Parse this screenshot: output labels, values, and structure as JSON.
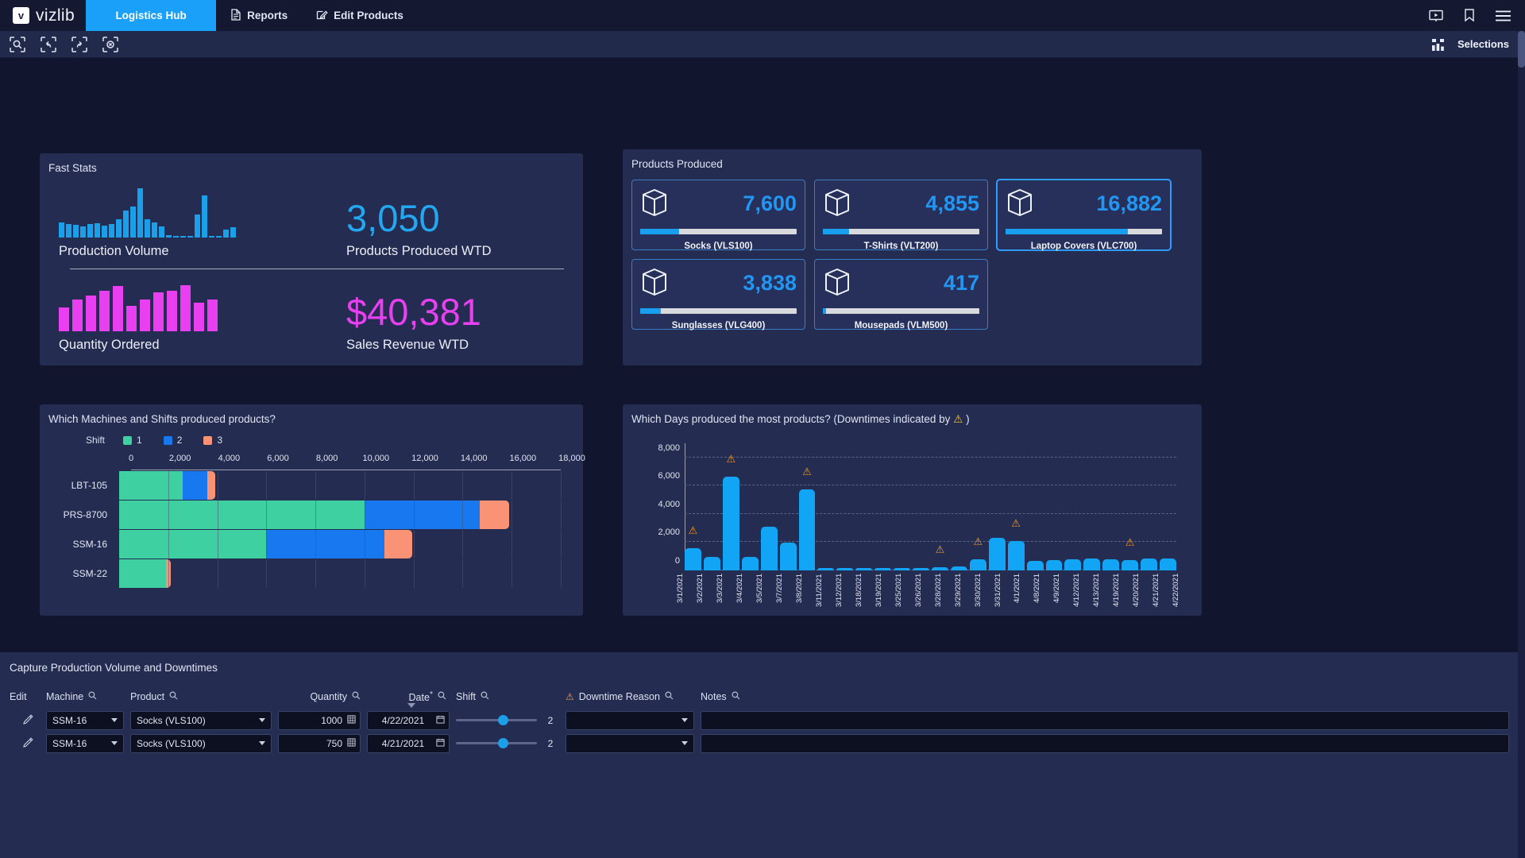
{
  "nav": {
    "logo_mark": "v",
    "logo_text": "vizlib",
    "tabs": [
      {
        "label": "Logistics Hub",
        "icon": "",
        "active": true
      },
      {
        "label": "Reports",
        "icon": "document-icon",
        "active": false
      },
      {
        "label": "Edit Products",
        "icon": "edit-icon",
        "active": false
      }
    ],
    "icons": [
      "presentation-icon",
      "bookmark-icon",
      "hamburger-menu-icon"
    ]
  },
  "toolbar": {
    "icons": [
      "selection-search-icon",
      "selection-back-icon",
      "selection-forward-icon",
      "selection-clear-icon"
    ],
    "selections_label": "Selections",
    "selections_icon": "selections-bars-icon"
  },
  "fast_stats": {
    "title": "Fast Stats",
    "rows": [
      {
        "caption": "Production Volume",
        "value": "3,050",
        "sub": "Products Produced WTD",
        "color": "#22a7f0"
      },
      {
        "caption": "Quantity Ordered",
        "value": "$40,381",
        "sub": "Sales Revenue WTD",
        "color": "#e83ff0"
      }
    ]
  },
  "products_produced": {
    "title": "Products Produced",
    "tiles": [
      {
        "value": "7,600",
        "name": "Socks (VLS100)",
        "pct": 25,
        "selected": false,
        "icon": "box-icon"
      },
      {
        "value": "4,855",
        "name": "T-Shirts (VLT200)",
        "pct": 17,
        "selected": false,
        "icon": "box-icon"
      },
      {
        "value": "16,882",
        "name": "Laptop Covers (VLC700)",
        "pct": 78,
        "selected": true,
        "icon": "box-icon"
      },
      {
        "value": "3,838",
        "name": "Sunglasses (VLG400)",
        "pct": 13,
        "selected": false,
        "icon": "box-icon"
      },
      {
        "value": "417",
        "name": "Mousepads (VLM500)",
        "pct": 2,
        "selected": false,
        "icon": "box-icon"
      }
    ]
  },
  "machines_chart": {
    "title": "Which Machines and Shifts produced products?",
    "legend_label": "Shift"
  },
  "days_chart": {
    "title_before": "Which Days produced the most products? (Downtimes indicated by",
    "title_after": ")",
    "warning_icon": "warning-triangle-icon"
  },
  "capture": {
    "title": "Capture Production Volume and Downtimes",
    "columns": [
      {
        "label": "Edit",
        "search": false,
        "warn": false,
        "required": false
      },
      {
        "label": "Machine",
        "search": true,
        "warn": false,
        "required": false
      },
      {
        "label": "Product",
        "search": true,
        "warn": false,
        "required": false
      },
      {
        "label": "Quantity",
        "search": true,
        "warn": false,
        "required": false
      },
      {
        "label": "Date",
        "search": true,
        "warn": false,
        "required": true
      },
      {
        "label": "Shift",
        "search": true,
        "warn": false,
        "required": false
      },
      {
        "label": "Downtime Reason",
        "search": true,
        "warn": true,
        "required": false
      },
      {
        "label": "Notes",
        "search": true,
        "warn": false,
        "required": false
      }
    ],
    "rows": [
      {
        "edit": "edit-icon",
        "machine": "SSM-16",
        "product": "Socks (VLS100)",
        "quantity": "1000",
        "date": "4/22/2021",
        "shift": "2",
        "shift_pct": 52,
        "downtime": "",
        "notes": ""
      },
      {
        "edit": "edit-icon",
        "machine": "SSM-16",
        "product": "Socks (VLS100)",
        "quantity": "750",
        "date": "4/21/2021",
        "shift": "2",
        "shift_pct": 52,
        "downtime": "",
        "notes": ""
      }
    ]
  },
  "chart_data": [
    {
      "type": "bar",
      "name": "production_volume_sparkline",
      "title": "Production Volume",
      "values": [
        340,
        300,
        280,
        250,
        300,
        330,
        270,
        300,
        420,
        620,
        700,
        1120,
        420,
        350,
        250,
        60,
        40,
        40,
        40,
        520,
        950,
        40,
        40,
        180,
        230
      ],
      "color": "#1a9fe8",
      "grid": false
    },
    {
      "type": "bar",
      "name": "quantity_ordered_sparkline",
      "title": "Quantity Ordered",
      "values": [
        520,
        700,
        780,
        880,
        1000,
        560,
        700,
        860,
        880,
        1010,
        620,
        700
      ],
      "color": "#e83ff0",
      "grid": false
    },
    {
      "type": "bar",
      "name": "machines_and_shifts",
      "title": "Which Machines and Shifts produced products?",
      "orientation": "horizontal",
      "stacked": true,
      "categories": [
        "LBT-105",
        "PRS-8700",
        "SSM-16",
        "SSM-22"
      ],
      "series": [
        {
          "name": "1",
          "color": "#3ed0a0",
          "values": [
            2600,
            10000,
            6000,
            1900
          ]
        },
        {
          "name": "2",
          "color": "#1878f0",
          "values": [
            1000,
            4700,
            4800,
            0
          ]
        },
        {
          "name": "3",
          "color": "#fa9275",
          "values": [
            330,
            1200,
            1150,
            220
          ]
        }
      ],
      "xlabel": "",
      "ylabel": "",
      "xlim": [
        0,
        18000
      ],
      "xticks": [
        0,
        2000,
        4000,
        6000,
        8000,
        10000,
        12000,
        14000,
        16000,
        18000
      ],
      "xticklabels": [
        "0",
        "2,000",
        "4,000",
        "6,000",
        "8,000",
        "10,000",
        "12,000",
        "14,000",
        "16,000",
        "18,000"
      ],
      "legend_title": "Shift",
      "legend_position": "top-left",
      "grid": true
    },
    {
      "type": "bar",
      "name": "days_produced",
      "title": "Which Days produced the most products? (Downtimes indicated by ⚠)",
      "categories": [
        "3/1/2021",
        "3/2/2021",
        "3/3/2021",
        "3/4/2021",
        "3/5/2021",
        "3/7/2021",
        "3/8/2021",
        "3/11/2021",
        "3/12/2021",
        "3/18/2021",
        "3/19/2021",
        "3/25/2021",
        "3/26/2021",
        "3/28/2021",
        "3/29/2021",
        "3/30/2021",
        "3/31/2021",
        "4/1/2021",
        "4/8/2021",
        "4/9/2021",
        "4/12/2021",
        "4/13/2021",
        "4/19/2021",
        "4/20/2021",
        "4/21/2021",
        "4/22/2021"
      ],
      "values": [
        1600,
        950,
        6650,
        950,
        3100,
        1950,
        5750,
        60,
        60,
        60,
        60,
        40,
        60,
        200,
        260,
        800,
        2300,
        2100,
        700,
        750,
        800,
        830,
        800,
        750,
        820,
        830
      ],
      "downtime_flags": [
        true,
        false,
        true,
        false,
        false,
        false,
        true,
        false,
        false,
        false,
        false,
        false,
        false,
        true,
        false,
        true,
        false,
        true,
        false,
        false,
        false,
        false,
        false,
        true,
        false,
        false
      ],
      "color": "#12a5f5",
      "ylim": [
        0,
        9000
      ],
      "yticks": [
        0,
        2000,
        4000,
        6000,
        8000
      ],
      "yticklabels": [
        "0",
        "2,000",
        "4,000",
        "6,000",
        "8,000"
      ],
      "xlabel": "",
      "ylabel": "",
      "grid": true
    }
  ]
}
